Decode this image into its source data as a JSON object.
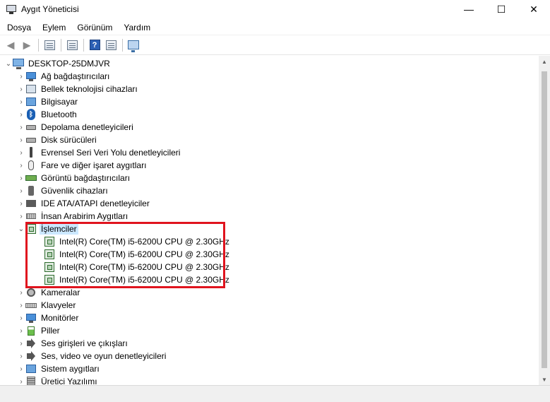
{
  "window": {
    "title": "Aygıt Yöneticisi",
    "controls": {
      "minimize": "—",
      "maximize": "☐",
      "close": "✕"
    }
  },
  "menu": {
    "items": [
      {
        "label": "Dosya"
      },
      {
        "label": "Eylem"
      },
      {
        "label": "Görünüm"
      },
      {
        "label": "Yardım"
      }
    ]
  },
  "toolbar": {
    "back_icon": "◄",
    "forward_icon": "►",
    "help_icon": "?"
  },
  "tree": {
    "root": {
      "label": "DESKTOP-25DMJVR",
      "expander": "⌄"
    },
    "categories": [
      {
        "label": "Ağ bağdaştırıcıları",
        "icon": "network-adapter-icon"
      },
      {
        "label": "Bellek teknolojisi cihazları",
        "icon": "memory-device-icon"
      },
      {
        "label": "Bilgisayar",
        "icon": "computer-icon"
      },
      {
        "label": "Bluetooth",
        "icon": "bluetooth-icon"
      },
      {
        "label": "Depolama denetleyicileri",
        "icon": "storage-controller-icon"
      },
      {
        "label": "Disk sürücüleri",
        "icon": "disk-drive-icon"
      },
      {
        "label": "Evrensel Seri Veri Yolu denetleyicileri",
        "icon": "usb-icon"
      },
      {
        "label": "Fare ve diğer işaret aygıtları",
        "icon": "mouse-icon"
      },
      {
        "label": "Görüntü bağdaştırıcıları",
        "icon": "display-adapter-icon"
      },
      {
        "label": "Güvenlik cihazları",
        "icon": "security-device-icon"
      },
      {
        "label": "IDE ATA/ATAPI denetleyiciler",
        "icon": "ide-controller-icon"
      },
      {
        "label": "İnsan Arabirim Aygıtları",
        "icon": "hid-icon"
      }
    ],
    "processors": {
      "label": "İşlemciler",
      "expander": "⌄",
      "children": [
        {
          "label": "Intel(R) Core(TM) i5-6200U CPU @ 2.30GHz"
        },
        {
          "label": "Intel(R) Core(TM) i5-6200U CPU @ 2.30GHz"
        },
        {
          "label": "Intel(R) Core(TM) i5-6200U CPU @ 2.30GHz"
        },
        {
          "label": "Intel(R) Core(TM) i5-6200U CPU @ 2.30GHz"
        }
      ]
    },
    "categories_after": [
      {
        "label": "Kameralar",
        "icon": "camera-icon"
      },
      {
        "label": "Klavyeler",
        "icon": "keyboard-icon"
      },
      {
        "label": "Monitörler",
        "icon": "monitor-icon"
      },
      {
        "label": "Piller",
        "icon": "battery-icon"
      },
      {
        "label": "Ses girişleri ve çıkışları",
        "icon": "audio-io-icon"
      },
      {
        "label": "Ses, video ve oyun denetleyicileri",
        "icon": "sound-video-icon"
      },
      {
        "label": "Sistem aygıtları",
        "icon": "system-device-icon"
      },
      {
        "label": "Üretici Yazılımı",
        "icon": "firmware-icon"
      }
    ],
    "collapsed_expander": "›"
  },
  "colors": {
    "highlight_border": "#e0141e",
    "selection_bg": "#cce8ff"
  }
}
